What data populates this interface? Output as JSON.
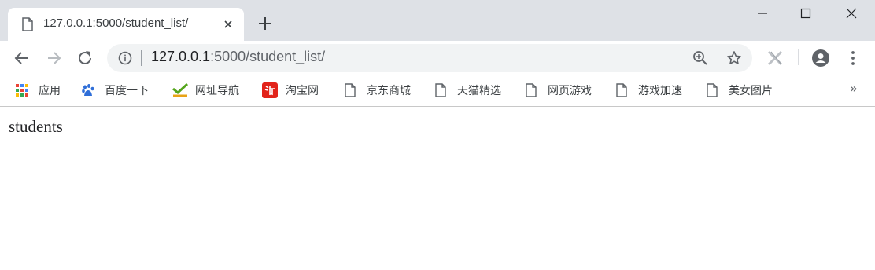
{
  "tab": {
    "title": "127.0.0.1:5000/student_list/"
  },
  "address_bar": {
    "host": "127.0.0.1",
    "path": ":5000/student_list/"
  },
  "bookmarks": [
    {
      "label": "应用",
      "icon": "apps-grid-icon"
    },
    {
      "label": "百度一下",
      "icon": "baidu-paw-icon"
    },
    {
      "label": "网址导航",
      "icon": "hao-check-icon"
    },
    {
      "label": "淘宝网",
      "icon": "taobao-icon"
    },
    {
      "label": "京东商城",
      "icon": "page-icon"
    },
    {
      "label": "天猫精选",
      "icon": "page-icon"
    },
    {
      "label": "网页游戏",
      "icon": "page-icon"
    },
    {
      "label": "游戏加速",
      "icon": "page-icon"
    },
    {
      "label": "美女图片",
      "icon": "page-icon"
    }
  ],
  "bookmarks_more": "»",
  "page": {
    "text": "students"
  },
  "colors": {
    "tabstrip": "#dee1e6",
    "omnibox": "#f1f3f4",
    "icon": "#5f6368",
    "taobao": "#e2231a",
    "hao": "#55a51c",
    "baidu": "#2f6ed8"
  }
}
